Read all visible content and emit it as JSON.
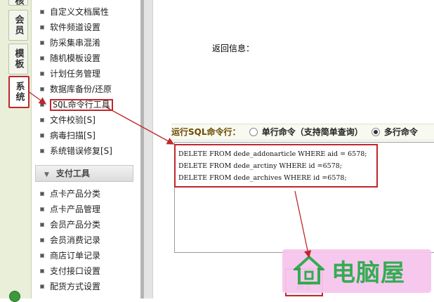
{
  "tabs": [
    {
      "label": "系统"
    },
    {
      "label": "会员"
    },
    {
      "label": "模板"
    },
    {
      "label": "系统"
    }
  ],
  "tab_top_partial": "核",
  "menu": {
    "group1": [
      {
        "label": "自定义文档属性"
      },
      {
        "label": "软件频道设置"
      },
      {
        "label": "防采集串混淆"
      },
      {
        "label": "随机模板设置"
      },
      {
        "label": "计划任务管理"
      },
      {
        "label": "数据库备份/还原"
      },
      {
        "label": "SQL命令行工具"
      },
      {
        "label": "文件校验[S]"
      },
      {
        "label": "病毒扫描[S]"
      },
      {
        "label": "系统错误修复[S]"
      }
    ],
    "section_payment": "支付工具",
    "group2": [
      {
        "label": "点卡产品分类"
      },
      {
        "label": "点卡产品管理"
      },
      {
        "label": "会员产品分类"
      },
      {
        "label": "会员消费记录"
      },
      {
        "label": "商店订单记录"
      },
      {
        "label": "支付接口设置"
      },
      {
        "label": "配货方式设置"
      }
    ]
  },
  "main": {
    "return_info": "返回信息：",
    "run_sql_label": "运行SQL命令行：",
    "single_option": "单行命令（支持简单查询）",
    "multi_option": "多行命令",
    "selected_mode": "multi",
    "sql_lines": [
      "DELETE FROM dede_addonarticle WHERE aid = 6578;",
      "DELETE FROM dede_arctiny WHERE id =6578;",
      "DELETE FROM dede_archives WHERE id =6578;"
    ],
    "ok_button": "确定"
  },
  "watermark": {
    "text": "电脑屋"
  },
  "colors": {
    "highlight": "#c0262c",
    "tab_bg": "#e9efd9",
    "watermark_bg": "#f7c6ee",
    "watermark_text": "#2aa84a"
  }
}
